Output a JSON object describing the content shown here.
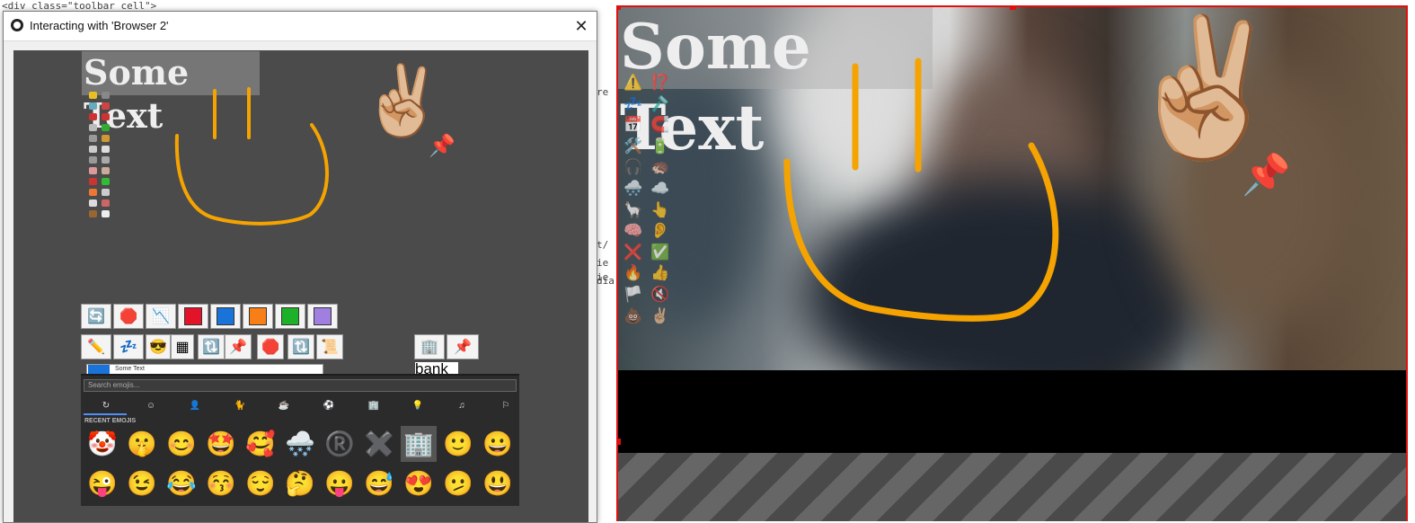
{
  "dialog": {
    "title": "Interacting with 'Browser 2'",
    "close_label": "✕"
  },
  "background_code": [
    "<div class=\"toolbar cell\">",
    "re",
    "t/",
    "ie",
    "ie",
    "dia"
  ],
  "browser": {
    "overlay_text": "Some Text",
    "text_input_value": "Some Text",
    "bank_label": "bank",
    "toolbar_row1": [
      {
        "name": "refresh-icon",
        "glyph": "🔄"
      },
      {
        "name": "stop-icon",
        "glyph": "🛑"
      },
      {
        "name": "chart-icon",
        "glyph": "📉"
      },
      {
        "name": "red-swatch",
        "color": "#e3142a"
      },
      {
        "name": "blue-swatch",
        "color": "#1a73d9"
      },
      {
        "name": "orange-swatch",
        "color": "#f77f16"
      },
      {
        "name": "green-swatch",
        "color": "#1db12a"
      },
      {
        "name": "purple-swatch",
        "color": "#9f7fe0"
      }
    ],
    "toolbar_row2": [
      {
        "name": "pencil-icon",
        "glyph": "✏️"
      },
      {
        "name": "zzz-icon",
        "glyph": "💤"
      },
      {
        "name": "sunglasses-icon",
        "glyph": "😎"
      },
      {
        "name": "grid-icon",
        "glyph": "▦"
      },
      {
        "name": "arrows-icon",
        "glyph": "🔃"
      },
      {
        "name": "pushpin-icon",
        "glyph": "📌"
      },
      {
        "name": "stop-icon",
        "glyph": "🛑"
      },
      {
        "name": "arrows-icon",
        "glyph": "🔃"
      },
      {
        "name": "scroll-icon",
        "glyph": "📜"
      }
    ],
    "side_buttons": [
      {
        "name": "office-building-icon",
        "glyph": "🏢"
      },
      {
        "name": "pushpin-icon",
        "glyph": "📌"
      }
    ]
  },
  "emoji_picker": {
    "search_placeholder": "Search emojis...",
    "recent_label": "RECENT EMOJIS",
    "categories": [
      {
        "name": "recent-icon",
        "glyph": "↻"
      },
      {
        "name": "smiley-icon",
        "glyph": "☺"
      },
      {
        "name": "person-icon",
        "glyph": "👤"
      },
      {
        "name": "animal-icon",
        "glyph": "🐈"
      },
      {
        "name": "food-icon",
        "glyph": "☕"
      },
      {
        "name": "activity-icon",
        "glyph": "⚽"
      },
      {
        "name": "building-icon",
        "glyph": "🏢"
      },
      {
        "name": "objects-icon",
        "glyph": "💡"
      },
      {
        "name": "symbols-icon",
        "glyph": "♫"
      },
      {
        "name": "flag-icon",
        "glyph": "⚐"
      }
    ],
    "recent_emojis": [
      "🤡",
      "🤫",
      "😊",
      "🤩",
      "🥰",
      "🌨️",
      "®️",
      "✖️",
      "🏢",
      "🙂",
      "😀",
      "😜",
      "😉",
      "😂",
      "😚",
      "😌",
      "🤔",
      "😛",
      "😅",
      "😍",
      "🫤",
      "😃"
    ],
    "selected_index": 8
  },
  "preview": {
    "overlay_text": "Some Text",
    "peace_hand": "✌🏼",
    "pushpin": "📌",
    "side_icons": [
      "⚠️",
      "⁉️",
      "💤",
      "🪒",
      "📅",
      "🧲",
      "🛠️",
      "🔋",
      "🎧",
      "🦔",
      "🌨️",
      "☁️",
      "🦙",
      "👆",
      "🧠",
      "👂",
      "❌",
      "✅",
      "🔥",
      "👍",
      "🏳️",
      "🔇",
      "💩",
      "✌🏼"
    ]
  },
  "colors": {
    "accent_orange": "#f5a300",
    "selection_red": "#e01010",
    "browser_bg": "#4b4b4b"
  }
}
